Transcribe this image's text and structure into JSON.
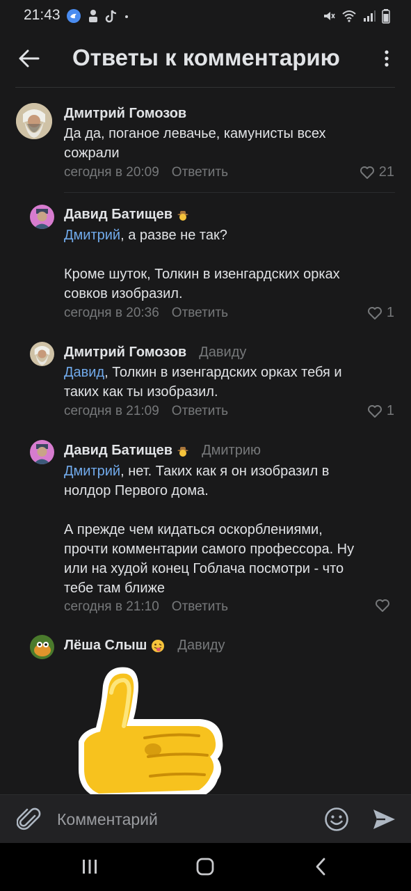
{
  "status_bar": {
    "time": "21:43",
    "notification_icons": [
      "vk-bird-icon",
      "person-icon",
      "tiktok-icon",
      "dot-icon"
    ],
    "system_icons": [
      "mute-icon",
      "wifi-icon",
      "signal-icon",
      "battery-icon"
    ]
  },
  "header": {
    "title": "Ответы к комментарию",
    "back_icon": "arrow-left-icon",
    "more_icon": "more-vertical-icon"
  },
  "comments": [
    {
      "author": "Дмитрий Гомозов",
      "reply_to": "",
      "mention": "",
      "text": "Да да, поганое левачье, камунисты всех\nсожрали",
      "time": "сегодня в 20:09",
      "reply_label": "Ответить",
      "likes": "21"
    },
    {
      "author": "Давид Батищев",
      "reply_to": "",
      "mention": "Дмитрий",
      "text": ", а разве не так?\n\nКроме шуток, Толкин в изенгардских орках\nсовков изобразил.",
      "time": "сегодня в 20:36",
      "reply_label": "Ответить",
      "likes": "1"
    },
    {
      "author": "Дмитрий Гомозов",
      "reply_to": "Давиду",
      "mention": "Давид",
      "text": ", Толкин в изенгардских орках тебя и\nтаких как ты изобразил.",
      "time": "сегодня в 21:09",
      "reply_label": "Ответить",
      "likes": "1"
    },
    {
      "author": "Давид Батищев",
      "reply_to": "Дмитрию",
      "mention": "Дмитрий",
      "text": ", нет. Таких как я он изобразил в\nнолдор Первого дома.\n\nА прежде чем кидаться оскорблениями,\nпрочти комментарии самого профессора. Ну\nили на худой конец Гоблача посмотри - что\nтебе там ближе",
      "time": "сегодня в 21:10",
      "reply_label": "Ответить",
      "likes": ""
    },
    {
      "author": "Лёша Слыш",
      "reply_to": "Давиду",
      "mention": "",
      "text": "",
      "time": "",
      "reply_label": "",
      "likes": ""
    }
  ],
  "composer": {
    "placeholder": "Комментарий",
    "attach_icon": "paperclip-icon",
    "emoji_icon": "smile-icon",
    "send_icon": "send-icon"
  },
  "colors": {
    "background": "#19191a",
    "text": "#e1e3e6",
    "secondary": "#76787a",
    "link": "#71aaeb"
  }
}
